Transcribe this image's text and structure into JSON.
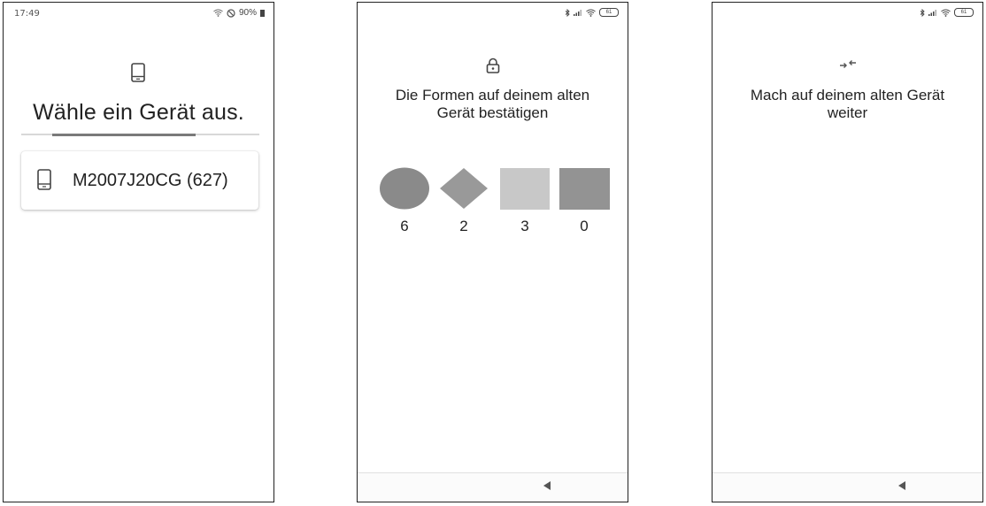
{
  "screen1": {
    "status": {
      "time": "17:49",
      "battery": "90%"
    },
    "title": "Wähle ein Gerät aus.",
    "device": {
      "name": "M2007J20CG (627)"
    }
  },
  "screen2": {
    "battery": "61",
    "title_line1": "Die Formen auf deinem alten",
    "title_line2": "Gerät bestätigen",
    "shapes": [
      {
        "shape": "circle",
        "color": "#8a8a8a",
        "number": "6"
      },
      {
        "shape": "diamond",
        "color": "#999999",
        "number": "2"
      },
      {
        "shape": "square",
        "color": "#c8c8c8",
        "number": "3"
      },
      {
        "shape": "square",
        "color": "#939393",
        "number": "0"
      }
    ]
  },
  "screen3": {
    "battery": "61",
    "title_line1": "Mach auf deinem alten Gerät",
    "title_line2": "weiter"
  }
}
